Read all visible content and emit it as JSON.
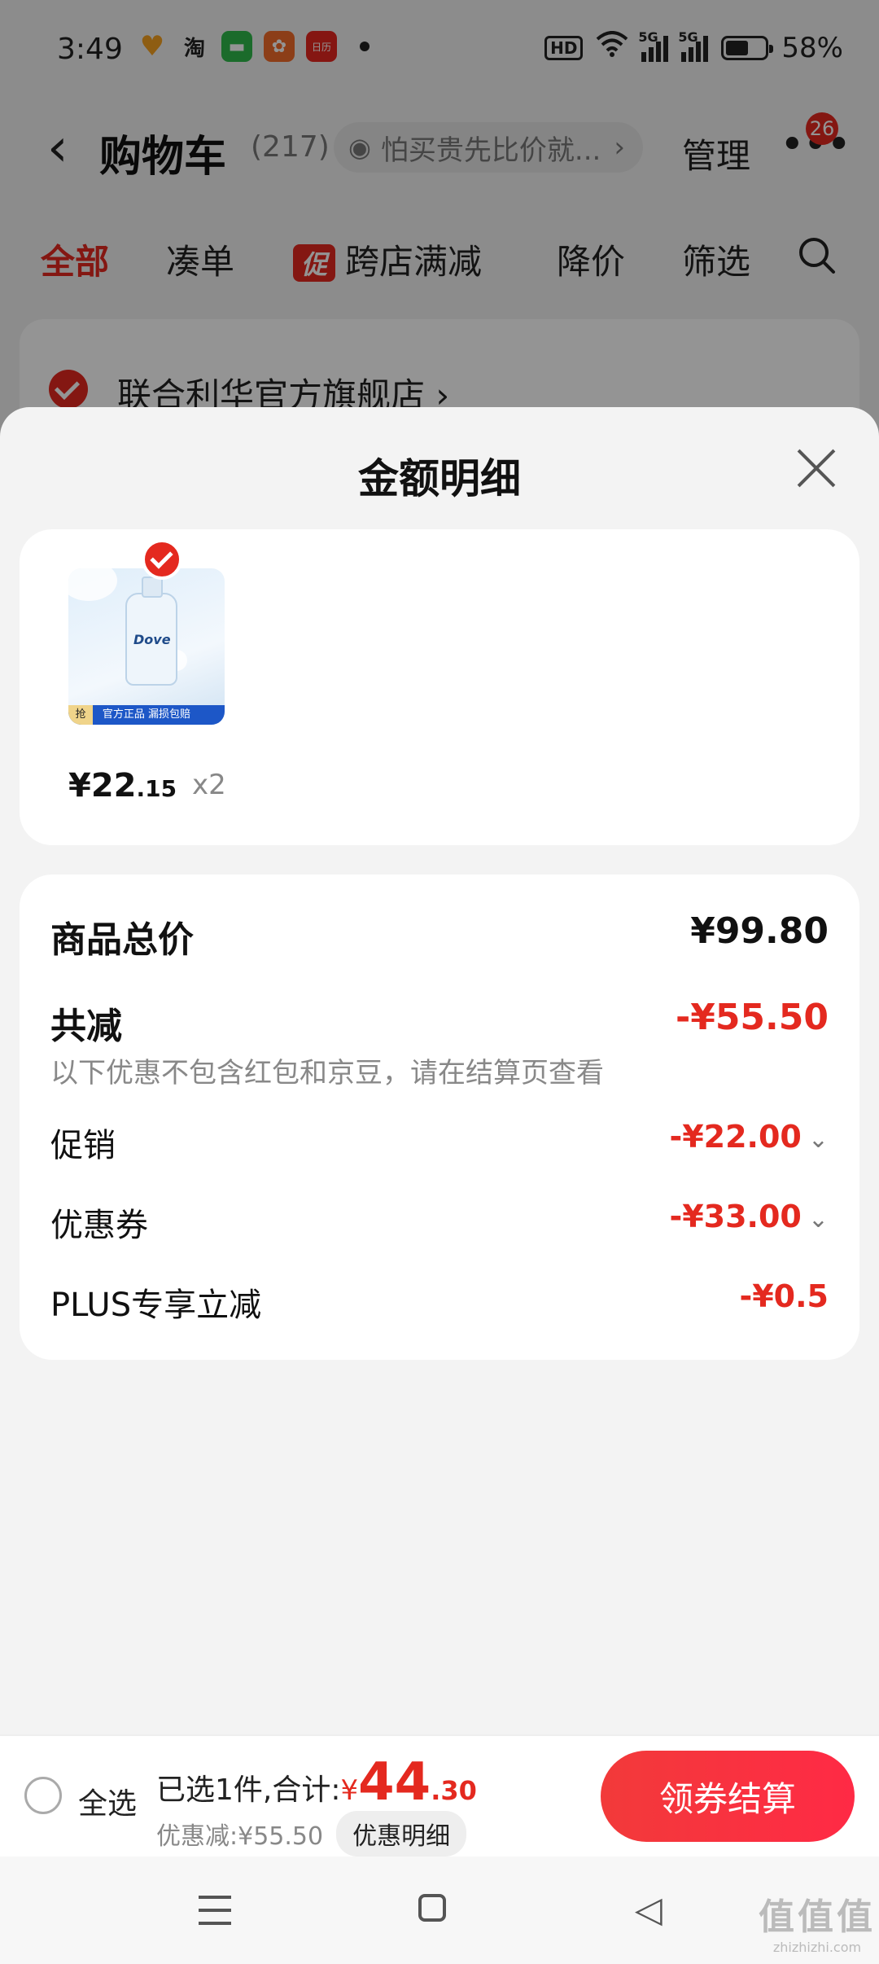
{
  "status_bar": {
    "time": "3:49",
    "app_icons": [
      "heart-app-icon",
      "taobao-icon",
      "message-app-icon",
      "orange-app-icon",
      "calendar-app-icon"
    ],
    "taobao_label": "淘",
    "calendar_label": "日历",
    "hd_label": "HD",
    "net1": "5G",
    "net2": "5G",
    "battery_text": "58%",
    "battery_level": 0.58
  },
  "header": {
    "title": "购物车",
    "count": "(217)",
    "hint": "怕买贵先比价就...",
    "manage": "管理",
    "more": "•••",
    "badge": "26"
  },
  "tabs": {
    "all": "全部",
    "bundle": "凑单",
    "promo_tag": "促",
    "cross_store": "跨店满减",
    "price_drop": "降价",
    "filter": "筛选"
  },
  "store": {
    "name": "联合利华官方旗舰店 ›"
  },
  "sheet": {
    "title": "金额明细",
    "product": {
      "brand": "Dove",
      "strip": "官方正品 漏损包赔",
      "strip_tag": "抢",
      "price_int": "¥22",
      "price_dec": ".15",
      "qty": "x2"
    },
    "summary": {
      "total_label": "商品总价",
      "total_value": "¥99.80",
      "reduce_label": "共减",
      "reduce_value": "-¥55.50",
      "note": "以下优惠不包含红包和京豆，请在结算页查看",
      "items": [
        {
          "label": "促销",
          "value": "-¥22.00"
        },
        {
          "label": "优惠券",
          "value": "-¥33.00"
        },
        {
          "label": "PLUS专享立减",
          "value": "-¥0.5"
        }
      ]
    }
  },
  "checkout_bar": {
    "select_all": "全选",
    "selected_prefix": "已选1件,合计:",
    "yen": "¥",
    "total_int": "44",
    "total_dec": ".30",
    "discount": "优惠减:¥55.50",
    "detail_button": "优惠明细",
    "checkout_button": "领券结算"
  },
  "watermark": {
    "big": "值值值",
    "small": "zhizhizhi.com"
  },
  "colors": {
    "accent": "#e4291f",
    "checkout_gradient_start": "#f23a3a",
    "checkout_gradient_end": "#ff2a45"
  }
}
